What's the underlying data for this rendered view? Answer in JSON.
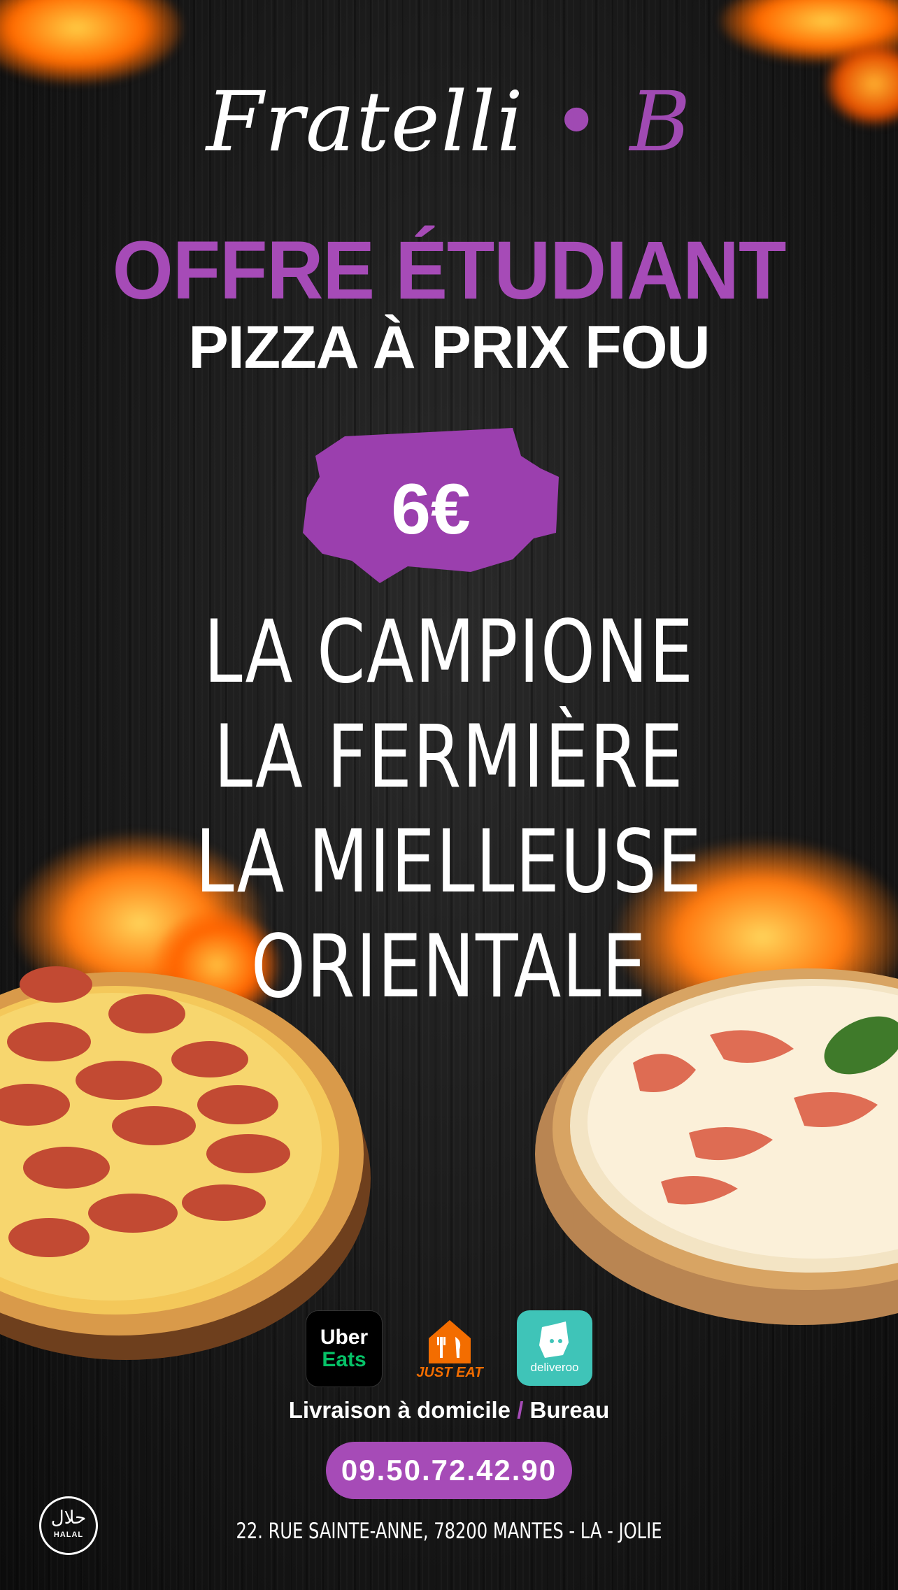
{
  "brand": {
    "name": "Fratelli",
    "dot": "•",
    "initial": "B"
  },
  "headline": {
    "offer": "OFFRE ÉTUDIANT",
    "subtitle": "PIZZA À PRIX FOU"
  },
  "price": "6€",
  "menu": {
    "items": [
      "LA CAMPIONE",
      "LA FERMIÈRE",
      "LA MIELLEUSE",
      "ORIENTALE"
    ]
  },
  "apps": {
    "uber_line1": "Uber",
    "uber_line2": "Eats",
    "justeat": "JUST EAT",
    "deliveroo": "deliveroo"
  },
  "delivery": {
    "part1": "Livraison à domicile",
    "separator": "/",
    "part2": "Bureau"
  },
  "phone": "09.50.72.42.90",
  "address": "22. RUE SAINTE-ANNE, 78200   MANTES - LA - JOLIE",
  "halal": {
    "arabic": "حلال",
    "label": "HALAL"
  },
  "colors": {
    "accent": "#a64bb7",
    "text": "#ffffff",
    "background": "#1a1a1a",
    "uber_green": "#06c167",
    "justeat_orange": "#f36d00",
    "deliveroo_teal": "#3fc4b8"
  },
  "icons": [
    "fire-icon",
    "pizza-pepperoni-image",
    "pizza-margherita-image",
    "uber-eats-logo",
    "just-eat-logo",
    "deliveroo-logo",
    "halal-badge-icon"
  ]
}
